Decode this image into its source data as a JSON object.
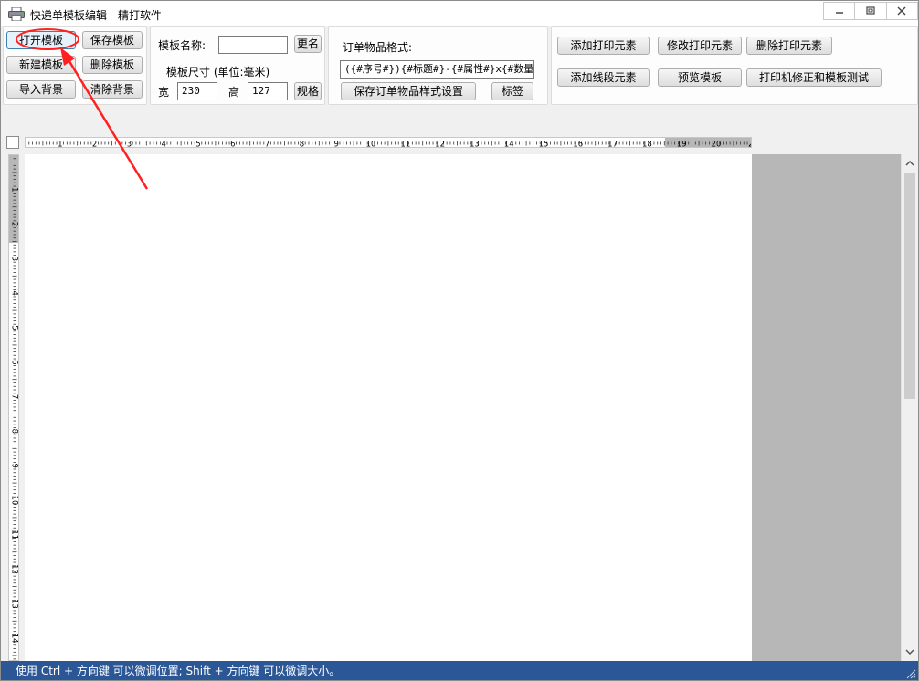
{
  "window": {
    "title": "快递单模板编辑 - 精打软件"
  },
  "template_group": {
    "open_template": "打开模板",
    "save_template": "保存模板",
    "new_template": "新建模板",
    "delete_template": "删除模板",
    "import_background": "导入背景",
    "clear_background": "清除背景"
  },
  "template_info": {
    "name_label": "模板名称:",
    "name_value": "",
    "rename_button": "更名",
    "size_label": "模板尺寸 (单位:毫米)",
    "width_label": "宽",
    "width_value": "230",
    "height_label": "高",
    "height_value": "127",
    "spec_button": "规格"
  },
  "order_items": {
    "format_label": "订单物品格式:",
    "format_value": "({#序号#}){#标题#}-{#属性#}x{#数量#",
    "save_format_button": "保存订单物品样式设置",
    "tags_button": "标签"
  },
  "elements": {
    "add_print_element": "添加打印元素",
    "edit_print_element": "修改打印元素",
    "delete_print_element": "删除打印元素",
    "add_line_element": "添加线段元素",
    "preview_template": "预览模板",
    "printer_correction": "打印机修正和模板测试"
  },
  "ruler": {
    "h_labels": [
      "1",
      "2",
      "3",
      "4",
      "5",
      "6",
      "7",
      "8",
      "9",
      "10",
      "11",
      "12",
      "13",
      "14",
      "15",
      "16",
      "17",
      "18",
      "19",
      "20",
      "2"
    ],
    "v_labels": [
      "1",
      "2",
      "3",
      "4",
      "5",
      "6",
      "7",
      "8",
      "9",
      "10",
      "11",
      "12",
      "13",
      "14"
    ]
  },
  "status": {
    "hint": "使用 Ctrl + 方向键 可以微调位置; Shift + 方向键 可以微调大小。"
  },
  "colors": {
    "statusbar": "#2b5797",
    "annotation": "#ff2020",
    "outside_area": "#b7b7b7"
  },
  "icons": {
    "app": "printer-icon",
    "minimize": "minimize-icon",
    "maximize": "maximize-icon",
    "close": "close-icon"
  }
}
